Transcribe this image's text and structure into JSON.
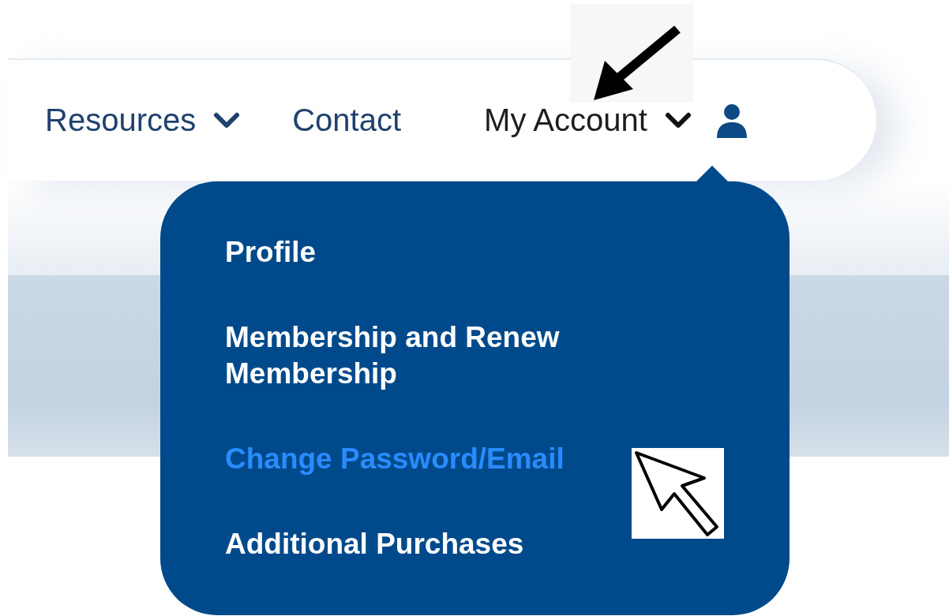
{
  "nav": {
    "items": [
      {
        "label": "Resources",
        "has_menu": true,
        "expanded": false
      },
      {
        "label": "Contact",
        "has_menu": false,
        "expanded": false
      },
      {
        "label": "My Account",
        "has_menu": true,
        "expanded": true
      }
    ]
  },
  "account_menu": {
    "items": [
      {
        "label": "Profile",
        "highlighted": false
      },
      {
        "label": "Membership and Renew Membership",
        "highlighted": false
      },
      {
        "label": "Change Password/Email",
        "highlighted": true
      },
      {
        "label": "Additional Purchases",
        "highlighted": false
      }
    ]
  }
}
